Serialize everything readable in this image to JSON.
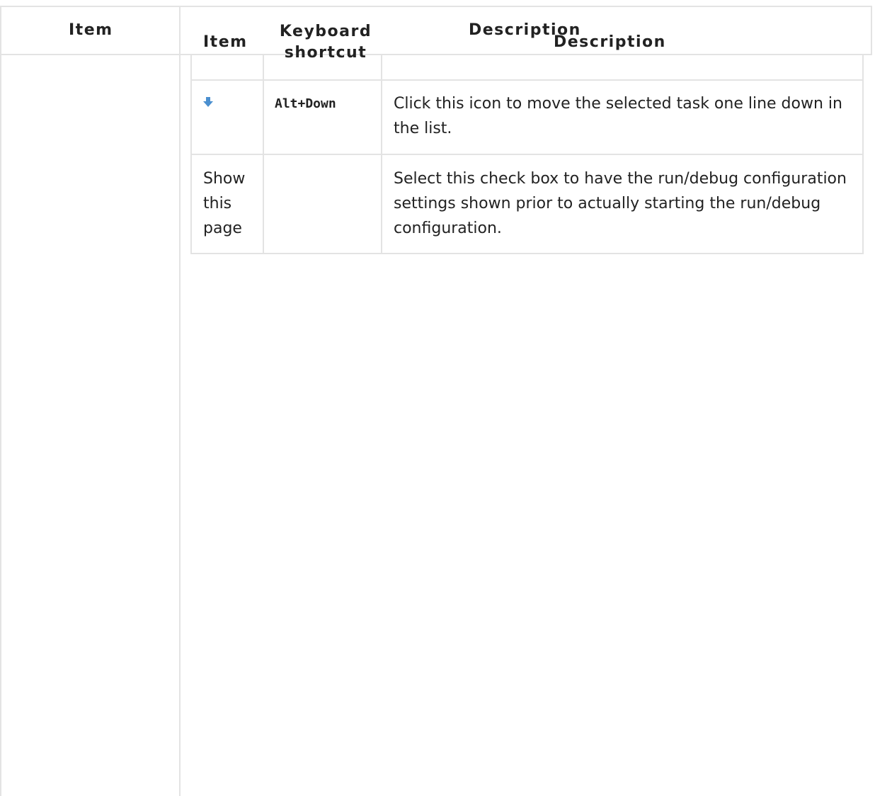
{
  "outer_table": {
    "headers": {
      "item": "Item",
      "description": "Description"
    }
  },
  "inner_table": {
    "headers": {
      "item": "Item",
      "shortcut": "Keyboard shortcut",
      "description": "Description"
    },
    "rows": [
      {
        "item_icon": "arrow-down-icon",
        "shortcut": "Alt+Down",
        "description": "Click this icon to move the selected task one line down in the list."
      },
      {
        "item": "Show this page",
        "shortcut": "",
        "description": "Select this check box to have the run/debug configuration settings shown prior to actually starting the run/debug configuration."
      }
    ]
  },
  "colors": {
    "border": "#e3e3e3",
    "icon_blue": "#4a8fcf"
  }
}
